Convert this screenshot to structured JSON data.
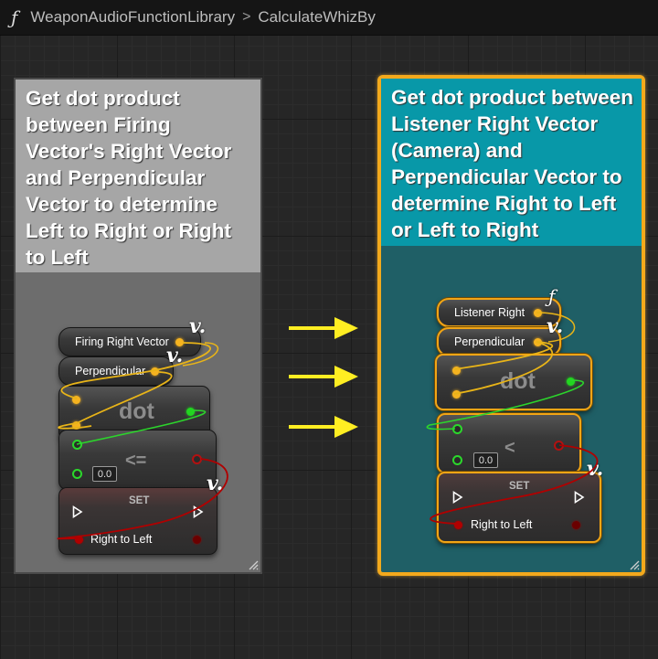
{
  "breadcrumb": {
    "icon": "function-icon",
    "library": "WeaponAudioFunctionLibrary",
    "separator": ">",
    "function": "CalculateWhizBy"
  },
  "left_comment": {
    "text": "Get dot product between Firing Vector's Right Vector and Perpendicular Vector to determine Left to Right or Right to Left",
    "color": "#a6a6a6",
    "nodes": {
      "get_firing": "Firing Right Vector",
      "get_perp": "Perpendicular",
      "dot": "dot",
      "compare": "<=",
      "compare_value": "0.0",
      "set_title": "SET",
      "set_var": "Right to Left"
    }
  },
  "right_comment": {
    "text": "Get dot product between Listener Right Vector (Camera) and Perpendicular Vector to determine Right to Left or Left to Right",
    "color": "#0898a8",
    "nodes": {
      "get_listener": "Listener Right",
      "get_perp": "Perpendicular",
      "dot": "dot",
      "compare": "<",
      "compare_value": "0.0",
      "set_title": "SET",
      "set_var": "Right to Left"
    }
  },
  "colors": {
    "accent_selection": "#f2a515",
    "arrow": "#ffee22",
    "vector_pin": "#f5b320",
    "float_pin": "#22d620",
    "bool_pin": "#b00000"
  }
}
